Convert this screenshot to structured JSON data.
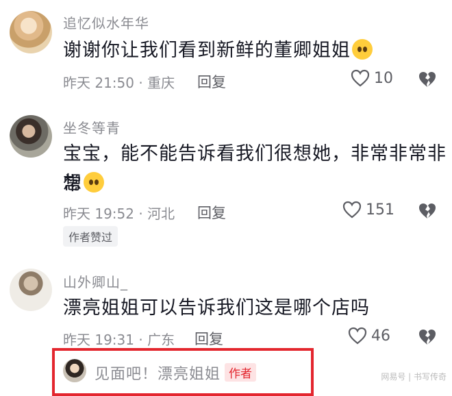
{
  "comments": [
    {
      "username": "追忆似水年华",
      "text": "谢谢你让我们看到新鲜的董卿姐姐",
      "emoji": "crying-face-emoji",
      "meta": "昨天 21:50 · 重庆",
      "reply_label": "回复",
      "likes": "10"
    },
    {
      "username": "坐冬等青",
      "text_line1": "宝宝，能不能告诉看我们很想她，非常非常非常",
      "text_line2": "想",
      "emoji": "pleading-face-emoji",
      "meta": "昨天 19:52 · 河北",
      "reply_label": "回复",
      "likes": "151",
      "badge": "作者赞过"
    },
    {
      "username": "山外卿山_",
      "text": "漂亮姐姐可以告诉我们这是哪个店吗",
      "meta": "昨天 19:31 · 广东",
      "reply_label": "回复",
      "likes": "46"
    }
  ],
  "author_reply": {
    "text": "见面吧！漂亮姐姐",
    "tag": "作者"
  },
  "watermark": "网易号 | 书写传奇",
  "colors": {
    "highlight_border": "#e3262e",
    "meta_gray": "#8a8b91"
  }
}
